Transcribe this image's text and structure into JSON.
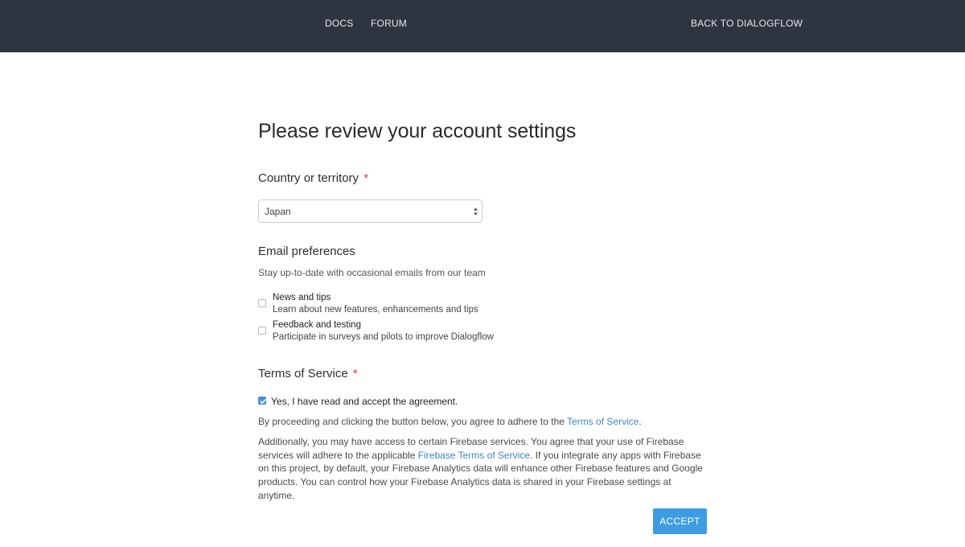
{
  "nav": {
    "docs": "DOCS",
    "forum": "FORUM",
    "back": "BACK TO DIALOGFLOW"
  },
  "page": {
    "title": "Please review your account settings"
  },
  "country": {
    "label": "Country or territory",
    "required_mark": "*",
    "selected": "Japan"
  },
  "email": {
    "title": "Email preferences",
    "subtitle": "Stay up-to-date with occasional emails from our team",
    "options": [
      {
        "title": "News and tips",
        "description": "Learn about new features, enhancements and tips",
        "checked": false
      },
      {
        "title": "Feedback and testing",
        "description": "Participate in surveys and pilots to improve Dialogflow",
        "checked": false
      }
    ]
  },
  "terms": {
    "title": "Terms of Service",
    "required_mark": "*",
    "agree_label": "Yes, I have read and accept the agreement.",
    "agree_checked": true,
    "para1_before": "By proceeding and clicking the button below, you agree to adhere to the ",
    "para1_link": "Terms of Service",
    "para1_after": ".",
    "para2_before": "Additionally, you may have access to certain Firebase services. You agree that your use of Firebase services will adhere to the applicable ",
    "para2_link": "Firebase Terms of Service",
    "para2_after": ". If you integrate any apps with Firebase on this project, by default, your Firebase Analytics data will enhance other Firebase features and Google products. You can control how your Firebase Analytics data is shared in your Firebase settings at anytime."
  },
  "actions": {
    "accept": "ACCEPT"
  },
  "colors": {
    "topbar": "#2f3441",
    "accent": "#3d9de0",
    "link": "#3c86cf",
    "required": "#e53935"
  }
}
